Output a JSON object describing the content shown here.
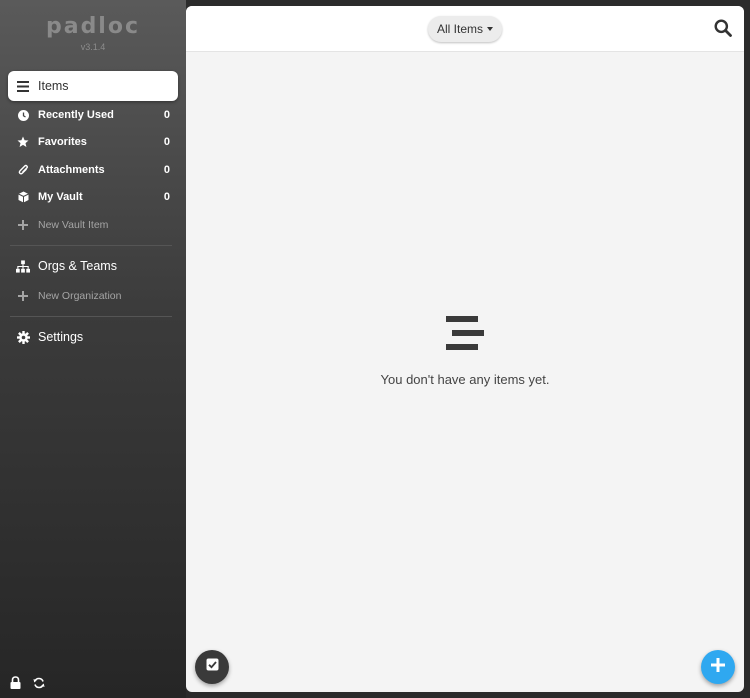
{
  "app": {
    "logo": "padloc",
    "version": "v3.1.4"
  },
  "sidebar": {
    "items": {
      "label": "Items"
    },
    "recent": {
      "label": "Recently Used",
      "count": "0"
    },
    "favorites": {
      "label": "Favorites",
      "count": "0"
    },
    "attachments": {
      "label": "Attachments",
      "count": "0"
    },
    "vault": {
      "label": "My Vault",
      "count": "0"
    },
    "new_vault_item": {
      "label": "New Vault Item"
    },
    "orgs": {
      "label": "Orgs & Teams"
    },
    "new_org": {
      "label": "New Organization"
    },
    "settings": {
      "label": "Settings"
    }
  },
  "header": {
    "filter_label": "All Items"
  },
  "main": {
    "empty_message": "You don't have any items yet."
  },
  "colors": {
    "accent": "#2fa8f0",
    "sidebar_top": "#5a5a5a",
    "sidebar_bottom": "#262626"
  }
}
